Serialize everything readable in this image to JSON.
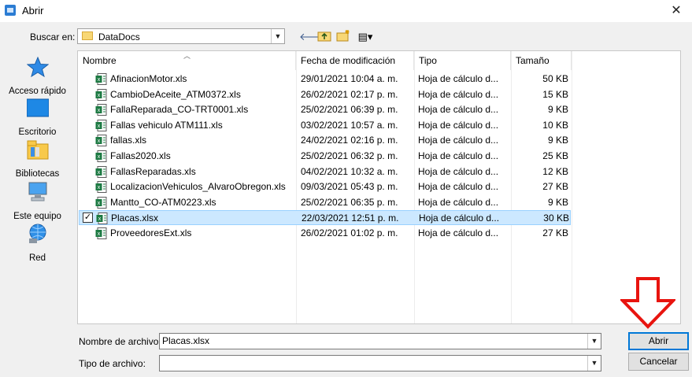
{
  "window": {
    "title": "Abrir",
    "close_glyph": "✕"
  },
  "lookin": {
    "label": "Buscar en:",
    "value": "DataDocs"
  },
  "toolbar": {
    "back_glyph": "🡐",
    "view_glyph": "▤▾"
  },
  "places": [
    {
      "label": "Acceso rápido",
      "icon": "star-icon"
    },
    {
      "label": "Escritorio",
      "icon": "desktop-icon"
    },
    {
      "label": "Bibliotecas",
      "icon": "libraries-icon"
    },
    {
      "label": "Este equipo",
      "icon": "computer-icon"
    },
    {
      "label": "Red",
      "icon": "network-icon"
    }
  ],
  "columns": {
    "name": "Nombre",
    "date": "Fecha de modificación",
    "type": "Tipo",
    "size": "Tamaño"
  },
  "files": [
    {
      "name": "AfinacionMotor.xls",
      "date": "29/01/2021 10:04 a. m.",
      "type": "Hoja de cálculo d...",
      "size": "50 KB"
    },
    {
      "name": "CambioDeAceite_ATM0372.xls",
      "date": "26/02/2021 02:17 p. m.",
      "type": "Hoja de cálculo d...",
      "size": "15 KB"
    },
    {
      "name": "FallaReparada_CO-TRT0001.xls",
      "date": "25/02/2021 06:39 p. m.",
      "type": "Hoja de cálculo d...",
      "size": "9 KB"
    },
    {
      "name": "Fallas vehiculo ATM111.xls",
      "date": "03/02/2021 10:57 a. m.",
      "type": "Hoja de cálculo d...",
      "size": "10 KB"
    },
    {
      "name": "fallas.xls",
      "date": "24/02/2021 02:16 p. m.",
      "type": "Hoja de cálculo d...",
      "size": "9 KB"
    },
    {
      "name": "Fallas2020.xls",
      "date": "25/02/2021 06:32 p. m.",
      "type": "Hoja de cálculo d...",
      "size": "25 KB"
    },
    {
      "name": "FallasReparadas.xls",
      "date": "04/02/2021 10:32 a. m.",
      "type": "Hoja de cálculo d...",
      "size": "12 KB"
    },
    {
      "name": "LocalizacionVehiculos_AlvaroObregon.xls",
      "date": "09/03/2021 05:43 p. m.",
      "type": "Hoja de cálculo d...",
      "size": "27 KB"
    },
    {
      "name": "Mantto_CO-ATM0223.xls",
      "date": "25/02/2021 06:35 p. m.",
      "type": "Hoja de cálculo d...",
      "size": "9 KB"
    },
    {
      "name": "Placas.xlsx",
      "date": "22/03/2021 12:51 p. m.",
      "type": "Hoja de cálculo d...",
      "size": "30 KB",
      "selected": true
    },
    {
      "name": "ProveedoresExt.xls",
      "date": "26/02/2021 01:02 p. m.",
      "type": "Hoja de cálculo d...",
      "size": "27 KB"
    }
  ],
  "filename": {
    "label": "Nombre de archivo:",
    "value": "Placas.xlsx"
  },
  "filetype": {
    "label": "Tipo de archivo:",
    "value": ""
  },
  "buttons": {
    "open": "Abrir",
    "cancel": "Cancelar"
  },
  "colors": {
    "annotation": "#e8140f",
    "selection": "#cce8ff",
    "excel_green": "#1d7a43"
  }
}
